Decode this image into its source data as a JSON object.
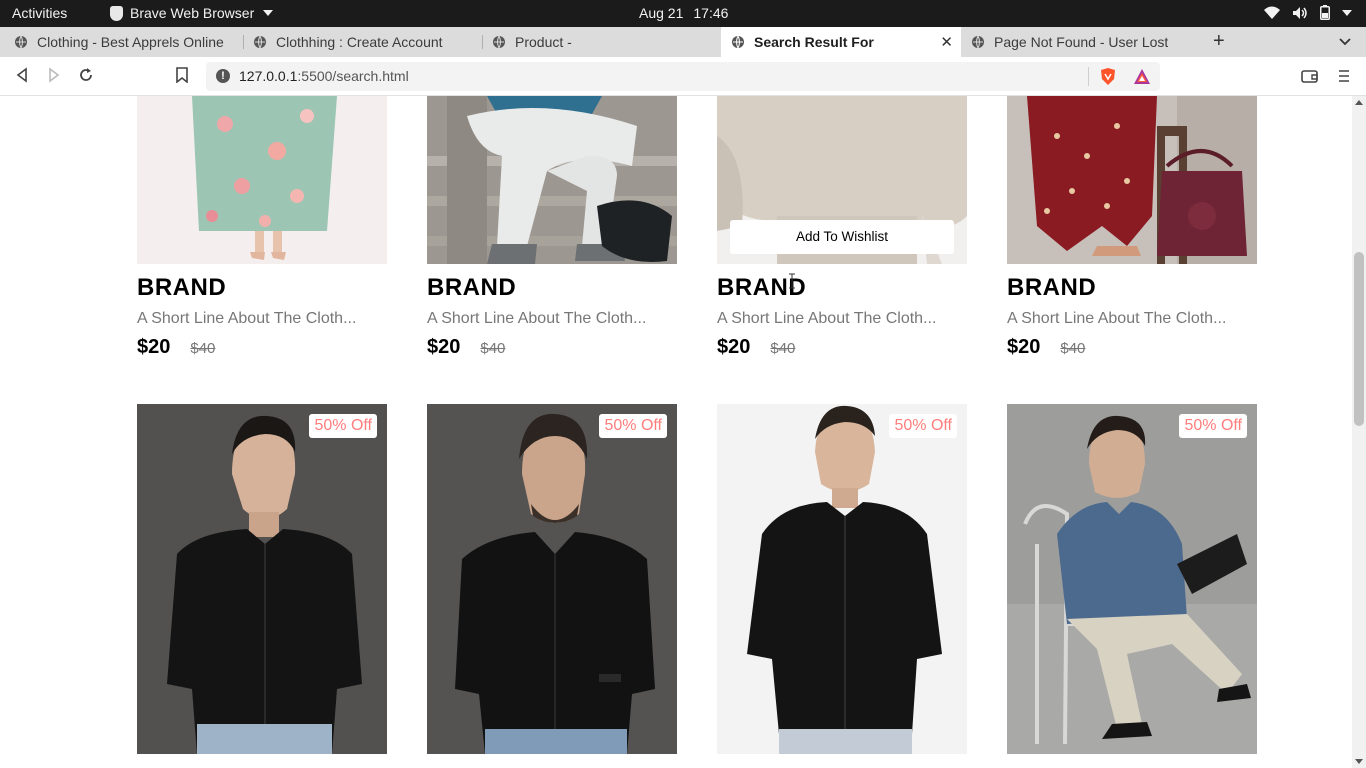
{
  "system_bar": {
    "activities": "Activities",
    "app_name": "Brave Web Browser",
    "date": "Aug 21",
    "time": "17:46"
  },
  "tabs": [
    {
      "title": "Clothing - Best Apprels Online",
      "active": false
    },
    {
      "title": "Clothhing : Create Account",
      "active": false
    },
    {
      "title": "Product -",
      "active": false
    },
    {
      "title": "Search Result For",
      "active": true
    },
    {
      "title": "Page Not Found - User Lost",
      "active": false
    }
  ],
  "address_bar": {
    "host": "127.0.0.1",
    "path": ":5500/search.html"
  },
  "products_row1": [
    {
      "brand": "BRAND",
      "desc": "A Short Line About The Cloth...",
      "price": "$20",
      "old_price": "$40",
      "image": "woman-floral-dress"
    },
    {
      "brand": "BRAND",
      "desc": "A Short Line About The Cloth...",
      "price": "$20",
      "old_price": "$40",
      "image": "man-white-joggers"
    },
    {
      "brand": "BRAND",
      "desc": "A Short Line About The Cloth...",
      "price": "$20",
      "old_price": "$40",
      "image": "beige-sweatshirt",
      "hover_action": "Add To Wishlist"
    },
    {
      "brand": "BRAND",
      "desc": "A Short Line About The Cloth...",
      "price": "$20",
      "old_price": "$40",
      "image": "woman-maroon-suit"
    }
  ],
  "products_row2": [
    {
      "discount": "50% Off",
      "image": "man-black-shirt-1"
    },
    {
      "discount": "50% Off",
      "image": "man-black-shirt-2"
    },
    {
      "discount": "50% Off",
      "image": "man-black-shirt-3"
    },
    {
      "discount": "50% Off",
      "image": "man-blue-shirt-chair"
    }
  ],
  "colors": {
    "discount_text": "#ff7d7d",
    "brave_orange": "#fb542b"
  }
}
